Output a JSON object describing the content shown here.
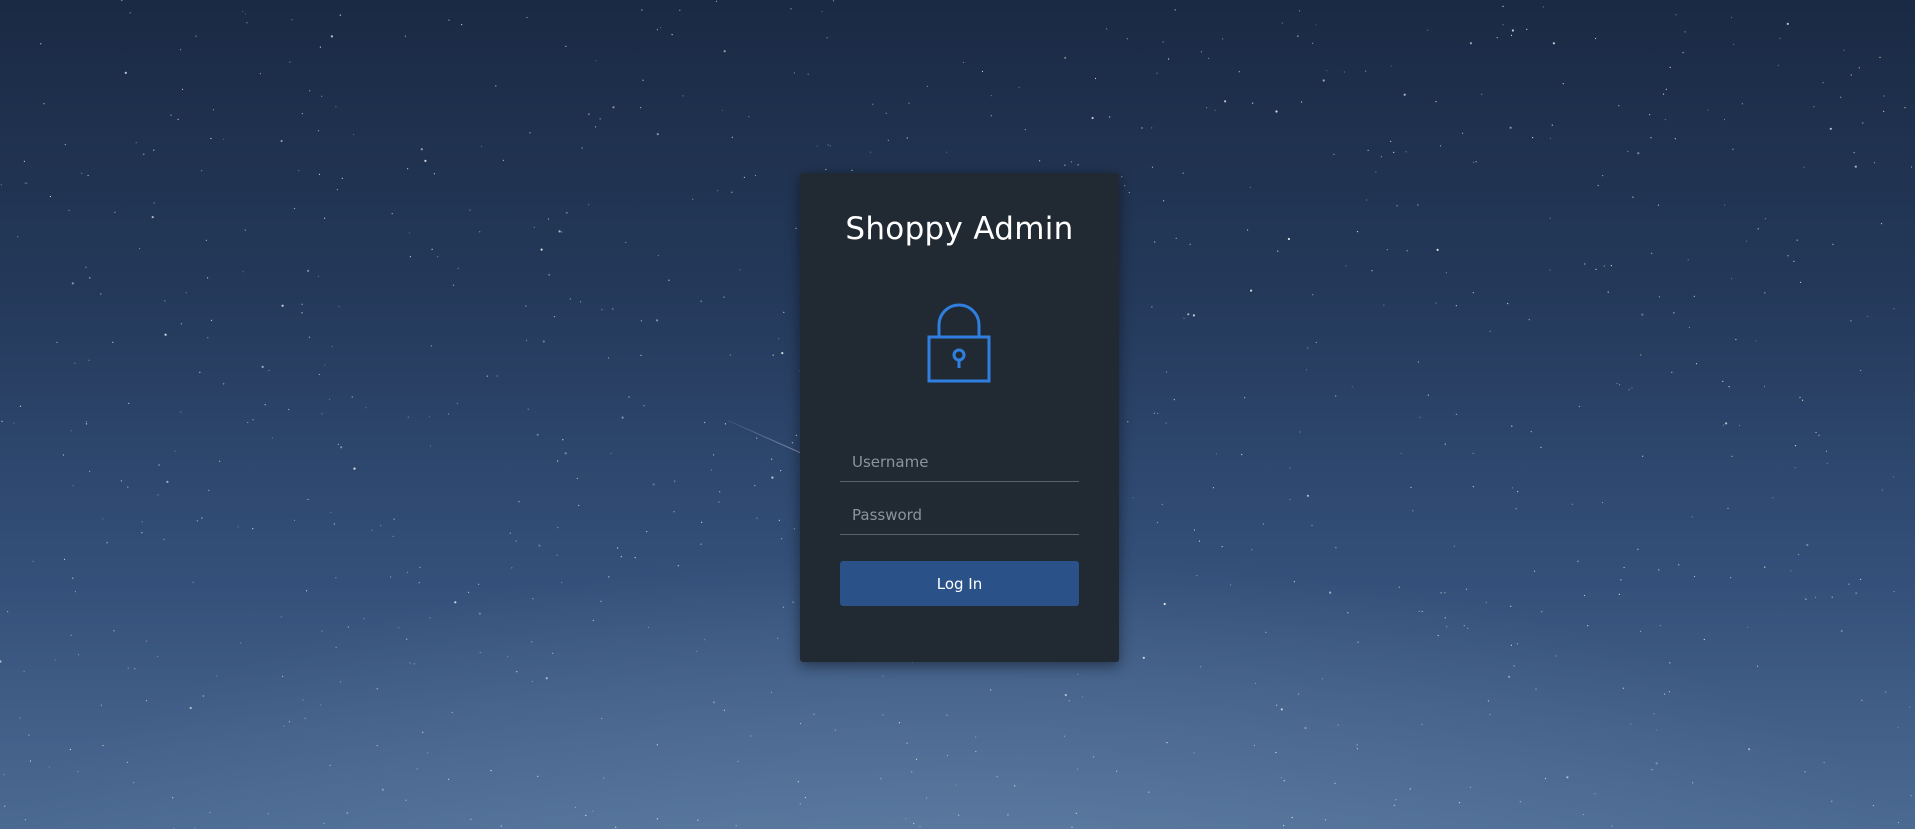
{
  "app": {
    "title": "Shoppy Admin"
  },
  "form": {
    "username_placeholder": "Username",
    "password_placeholder": "Password",
    "username_value": "",
    "password_value": "",
    "submit_label": "Log In"
  },
  "icons": {
    "lock": "lock-icon"
  },
  "colors": {
    "accent": "#2f7fe0",
    "button": "#2a5188",
    "card": "#212a33",
    "background_top": "#1a2a44",
    "background_bottom": "#4b6a92"
  }
}
